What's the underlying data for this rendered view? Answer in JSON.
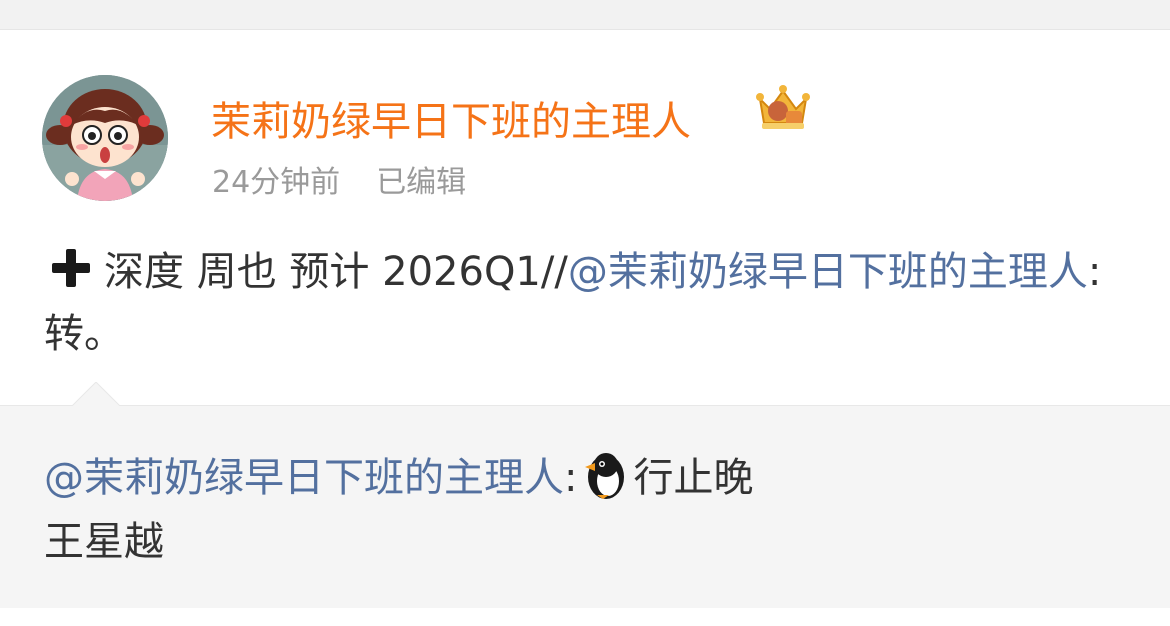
{
  "post": {
    "username": "茉莉奶绿早日下班的主理人",
    "time": "24分钟前",
    "edited": "已编辑",
    "text_before": "深度 周也  预计 2026Q1//",
    "mention": "@茉莉奶绿早日下班的主理人",
    "text_after": ":转。"
  },
  "repost": {
    "mention": "@茉莉奶绿早日下班的主理人",
    "after_mention": ":",
    "text1": "行止晚",
    "line2": "王星越"
  },
  "colors": {
    "username": "#f57317",
    "mention": "#53709f",
    "meta": "#9a9a9a",
    "text": "#333333",
    "repost_bg": "#f5f5f5"
  },
  "icons": {
    "badge": "crown-icon",
    "plus": "plus-icon",
    "emoji": "penguin-icon"
  }
}
